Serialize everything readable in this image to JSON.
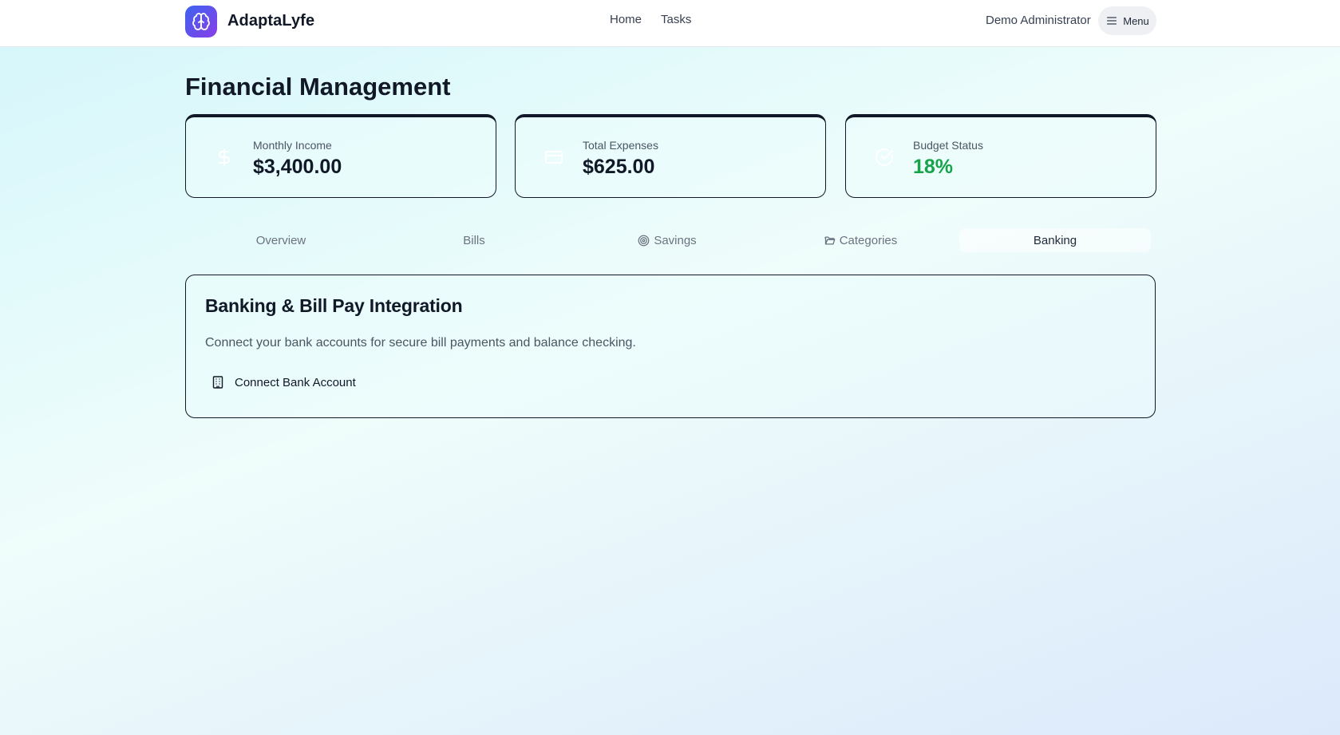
{
  "header": {
    "brand_name": "AdaptaLyfe",
    "logo_icon": "brain-icon",
    "nav": [
      {
        "label": "Home"
      },
      {
        "label": "Tasks"
      }
    ],
    "user_name": "Demo Administrator",
    "menu_label": "Menu",
    "menu_icon": "hamburger-icon"
  },
  "page": {
    "title": "Financial Management"
  },
  "stats": [
    {
      "label": "Monthly Income",
      "value": "$3,400.00",
      "icon": "dollar-icon"
    },
    {
      "label": "Total Expenses",
      "value": "$625.00",
      "icon": "credit-card-icon"
    },
    {
      "label": "Budget Status",
      "value": "18%",
      "icon": "check-circle-icon",
      "value_color": "#16a34a"
    }
  ],
  "tabs": [
    {
      "label": "Overview",
      "icon": null
    },
    {
      "label": "Bills",
      "icon": null
    },
    {
      "label": "Savings",
      "icon": "target-icon"
    },
    {
      "label": "Categories",
      "icon": "folder-icon"
    },
    {
      "label": "Banking",
      "icon": null,
      "active": true
    }
  ],
  "banking": {
    "title": "Banking & Bill Pay Integration",
    "description": "Connect your bank accounts for secure bill payments and balance checking.",
    "connect_label": "Connect Bank Account",
    "connect_icon": "building-icon"
  },
  "colors": {
    "accent_gradient_start": "#3b63f0",
    "accent_gradient_end": "#8a3ee8",
    "positive": "#16a34a"
  }
}
